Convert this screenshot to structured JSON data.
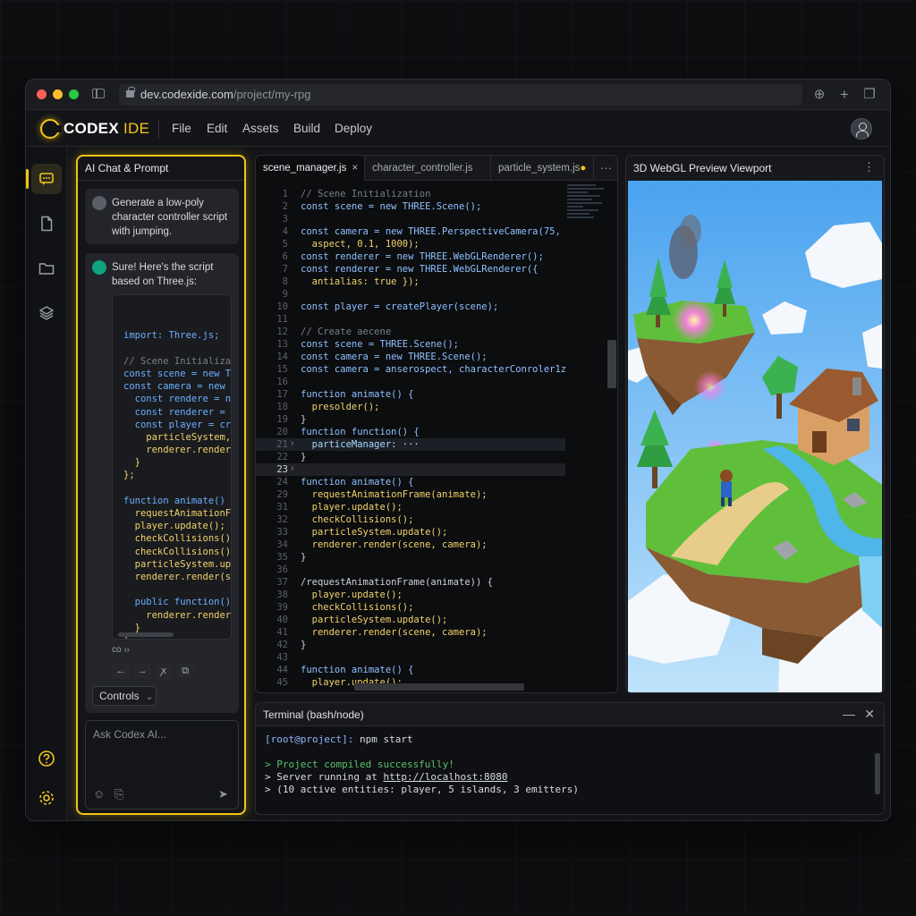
{
  "browser": {
    "url_host": "dev.codexide.com",
    "url_path": "/project/my-rpg"
  },
  "app": {
    "name": "CODEX",
    "name_suffix": "IDE",
    "menu": [
      "File",
      "Edit",
      "Assets",
      "Build",
      "Deploy"
    ]
  },
  "chat": {
    "title": "AI Chat & Prompt",
    "user_message": "Generate a low-poly character controller script with jumping.",
    "ai_message": "Sure! Here's the script based on Three.js:",
    "ai_code": [
      "import: Three.js;",
      "",
      "// Scene Initializa",
      "const scene = new T",
      "const camera = new ",
      "  const rendere = n",
      "  const renderer = ",
      "  const player = cr",
      "    particleSystem,",
      "    renderer.render",
      "  }",
      "};",
      "",
      "function animate()",
      "  requestAnimationF",
      "  player.update();",
      "  checkCollisions()",
      "  checkCollisions()",
      "  particleSystem.up",
      "  renderer.render(s",
      "",
      "  public function()",
      "    renderer.render",
      "  }",
      "}"
    ],
    "misc_text": "co ››",
    "controls_label": "Controls",
    "ask_placeholder": "Ask Codex AI..."
  },
  "editor": {
    "tabs": [
      {
        "label": "scene_manager.js",
        "active": true,
        "close": "×"
      },
      {
        "label": "character_controller.js",
        "active": false
      },
      {
        "label": "particle_system.js",
        "active": false,
        "modified": "●"
      }
    ],
    "line_numbers": [
      "1",
      "2",
      "3",
      "4",
      "5",
      "6",
      "7",
      "8",
      "9",
      "10",
      "11",
      "12",
      "13",
      "14",
      "15",
      "16",
      "17",
      "18",
      "19",
      "20",
      "21",
      "22",
      "23",
      "24",
      "29",
      "31",
      "32",
      "33",
      "34",
      "35",
      "36",
      "37",
      "38",
      "39",
      "40",
      "41",
      "42",
      "43",
      "44",
      "45"
    ],
    "lines": [
      "// Scene Initialization",
      "const scene = new THREE.Scene();",
      "",
      "const camera = new THREE.PerspectiveCamera(75,",
      "  aspect, 0.1, 1000);",
      "const renderer = new THREE.WebGLRenderer();",
      "const renderer = new THREE.WebGLRenderer({",
      "  antialias: true });",
      "",
      "const player = createPlayer(scene);",
      "",
      "// Create aecene",
      "const scene = THREE.Scene();",
      "const camera = new THREE.Scene();",
      "const camera = anserospect, characterConroler1z",
      "",
      "function animate() {",
      "  presolder();",
      "}",
      "function function() {",
      "  particeManager: ···",
      "}",
      "",
      "function animate() {",
      "  requestAnimationFrame(animate);",
      "  player.update();",
      "  checkCollisions();",
      "  particleSystem.update();",
      "  renderer.render(scene, camera);",
      "}",
      "",
      "/requestAnimationFrame(animate)) {",
      "  player.update();",
      "  checkCollisions();",
      "  particleSystem.update();",
      "  renderer.render(scene, camera);",
      "}",
      "",
      "function animate() {",
      "  player.update();"
    ]
  },
  "viewport": {
    "title": "3D WebGL Preview Viewport"
  },
  "terminal": {
    "title": "Terminal (bash/node)",
    "prompt": "[root@project]:",
    "command": " npm start",
    "line1": "> Project compiled successfully!",
    "line2_prefix": "> Server running at ",
    "line2_url": "http://localhost:8080",
    "line3": "> (10 active entities: player, 5 islands, 3 emitters)"
  },
  "icons": {
    "activity": [
      "chat-icon",
      "file-icon",
      "folder-icon",
      "layers-icon",
      "help-icon",
      "settings-icon"
    ]
  },
  "colors": {
    "accent": "#f5c518",
    "keyword": "#6ab0ff",
    "function": "#f2d36b",
    "success": "#59c36a"
  }
}
